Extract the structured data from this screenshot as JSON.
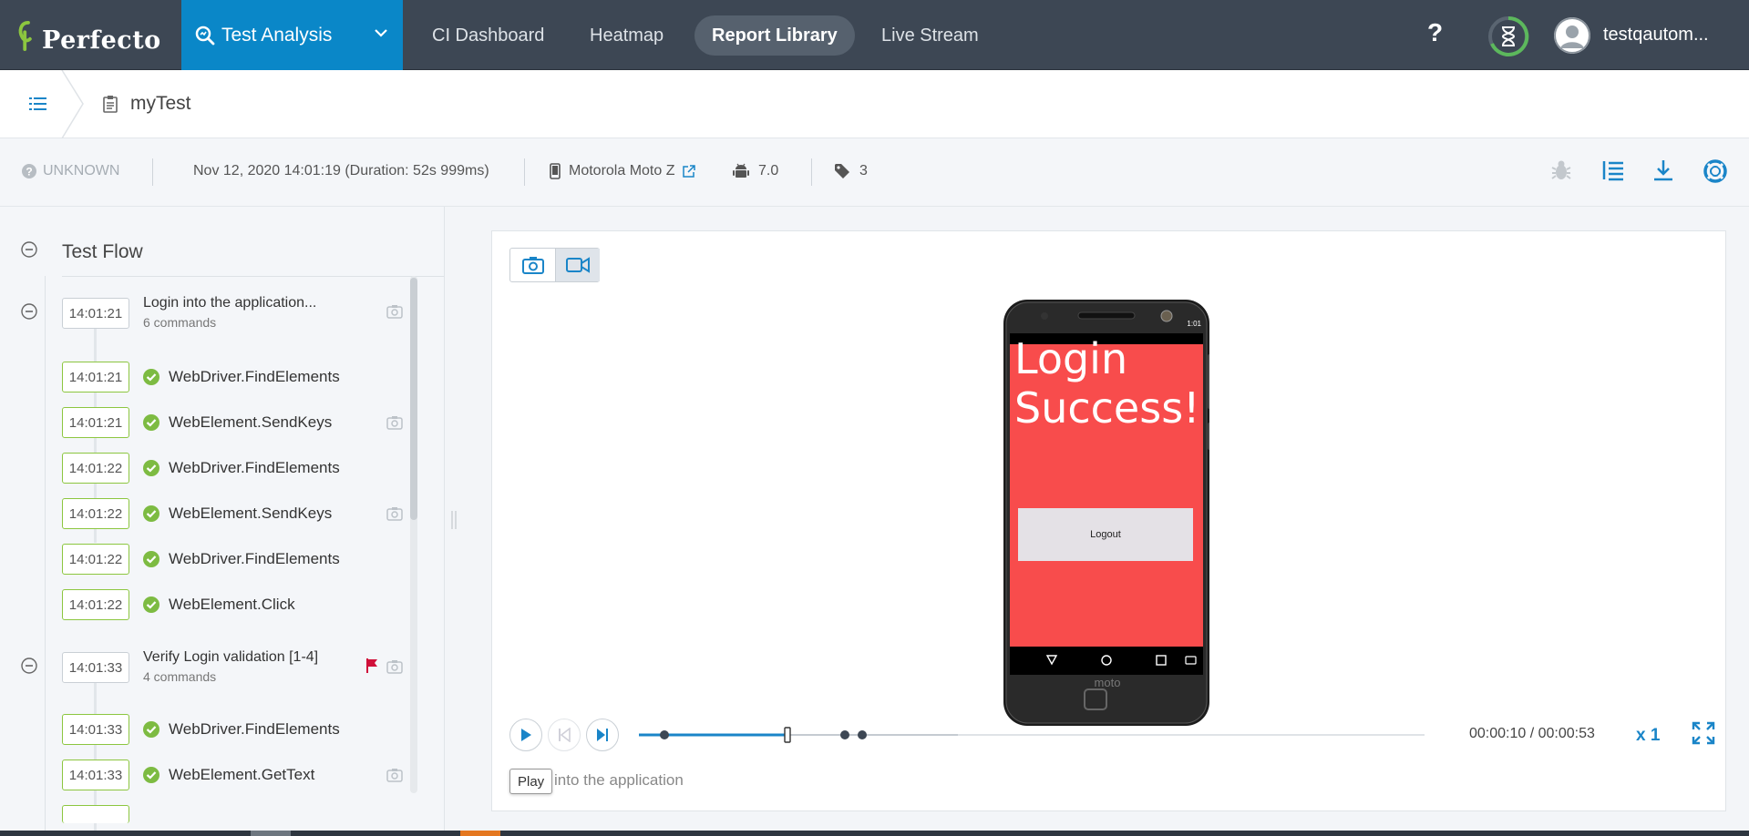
{
  "brand": {
    "name": "Perfecto"
  },
  "app_select": {
    "label": "Test Analysis"
  },
  "nav": {
    "links": [
      "CI Dashboard",
      "Heatmap",
      "Report Library",
      "Live Stream"
    ],
    "active": "Report Library",
    "help": "?",
    "username": "testqautom..."
  },
  "breadcrumb": {
    "title": "myTest"
  },
  "info": {
    "status": "UNKNOWN",
    "datetime": "Nov 12, 2020 14:01:19 (Duration: 52s 999ms)",
    "device": "Motorola Moto Z",
    "os_version": "7.0",
    "tags_count": "3"
  },
  "test_flow": {
    "title": "Test Flow",
    "groups": [
      {
        "time": "14:01:21",
        "title": "Login into the application...",
        "subtitle": "6 commands",
        "commands": [
          {
            "time": "14:01:21",
            "label": "WebDriver.FindElements",
            "has_screenshot": false
          },
          {
            "time": "14:01:21",
            "label": "WebElement.SendKeys",
            "has_screenshot": true
          },
          {
            "time": "14:01:22",
            "label": "WebDriver.FindElements",
            "has_screenshot": false
          },
          {
            "time": "14:01:22",
            "label": "WebElement.SendKeys",
            "has_screenshot": true
          },
          {
            "time": "14:01:22",
            "label": "WebDriver.FindElements",
            "has_screenshot": false
          },
          {
            "time": "14:01:22",
            "label": "WebElement.Click",
            "has_screenshot": false
          }
        ]
      },
      {
        "time": "14:01:33",
        "title": "Verify Login validation  [1-4]",
        "subtitle": "4 commands",
        "flagged": true,
        "commands": [
          {
            "time": "14:01:33",
            "label": "WebDriver.FindElements",
            "has_screenshot": false
          },
          {
            "time": "14:01:33",
            "label": "WebElement.GetText",
            "has_screenshot": true
          }
        ]
      }
    ]
  },
  "device_screen": {
    "statusbar_time": "1:01",
    "heading_line1": "Login",
    "heading_line2": "Success!",
    "logout_button": "Logout",
    "brand_mark": "moto"
  },
  "player": {
    "current_time": "00:00:10",
    "total_time": "00:00:53",
    "time_readout": "00:00:10 / 00:00:53",
    "speed": "x 1",
    "caption": "into the application",
    "tooltip": "Play",
    "progress": 0.189
  },
  "colors": {
    "topbar": "#3d4754",
    "accent": "#0a87c8",
    "success": "#7dbb42",
    "device_bg": "#f84c4c",
    "flag": "#d0103a"
  }
}
